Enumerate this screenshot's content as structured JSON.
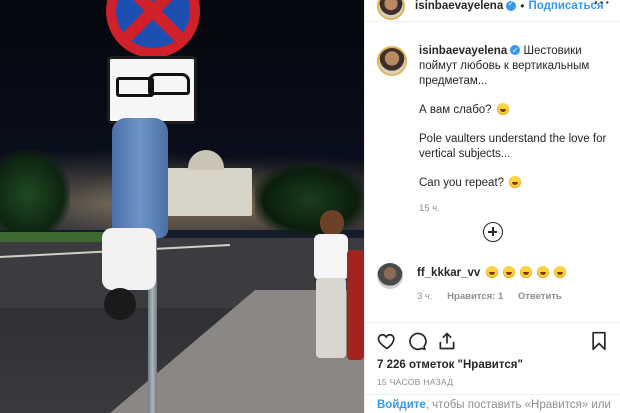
{
  "post": {
    "photo_description_icon": "photo"
  },
  "header": {
    "username": "isinbaevayelena",
    "separator": "•",
    "follow_label": "Подписаться",
    "more_label": "···"
  },
  "caption": {
    "username": "isinbaevayelena",
    "line1": "Шестовики поймут любовь к вертикальным предметам...",
    "line2": "А вам слабо?",
    "line3": "Pole vaulters understand the love for vertical subjects...",
    "line4": "Can you repeat?",
    "time": "15 ч."
  },
  "comment": {
    "username": "ff_kkkar_vv",
    "emoji_count": 5,
    "time": "3 ч.",
    "likes": "Нравится: 1",
    "reply": "Ответить"
  },
  "actions": {
    "likes_text": "7 226 отметок \"Нравится\"",
    "time_ago": "15 ЧАСОВ НАЗАД"
  },
  "footer": {
    "login_link": "Войдите",
    "login_text": ", чтобы поставить «Нравится» или"
  },
  "colors": {
    "accent": "#3897f0",
    "text": "#262626",
    "muted": "#8e8e8e"
  }
}
